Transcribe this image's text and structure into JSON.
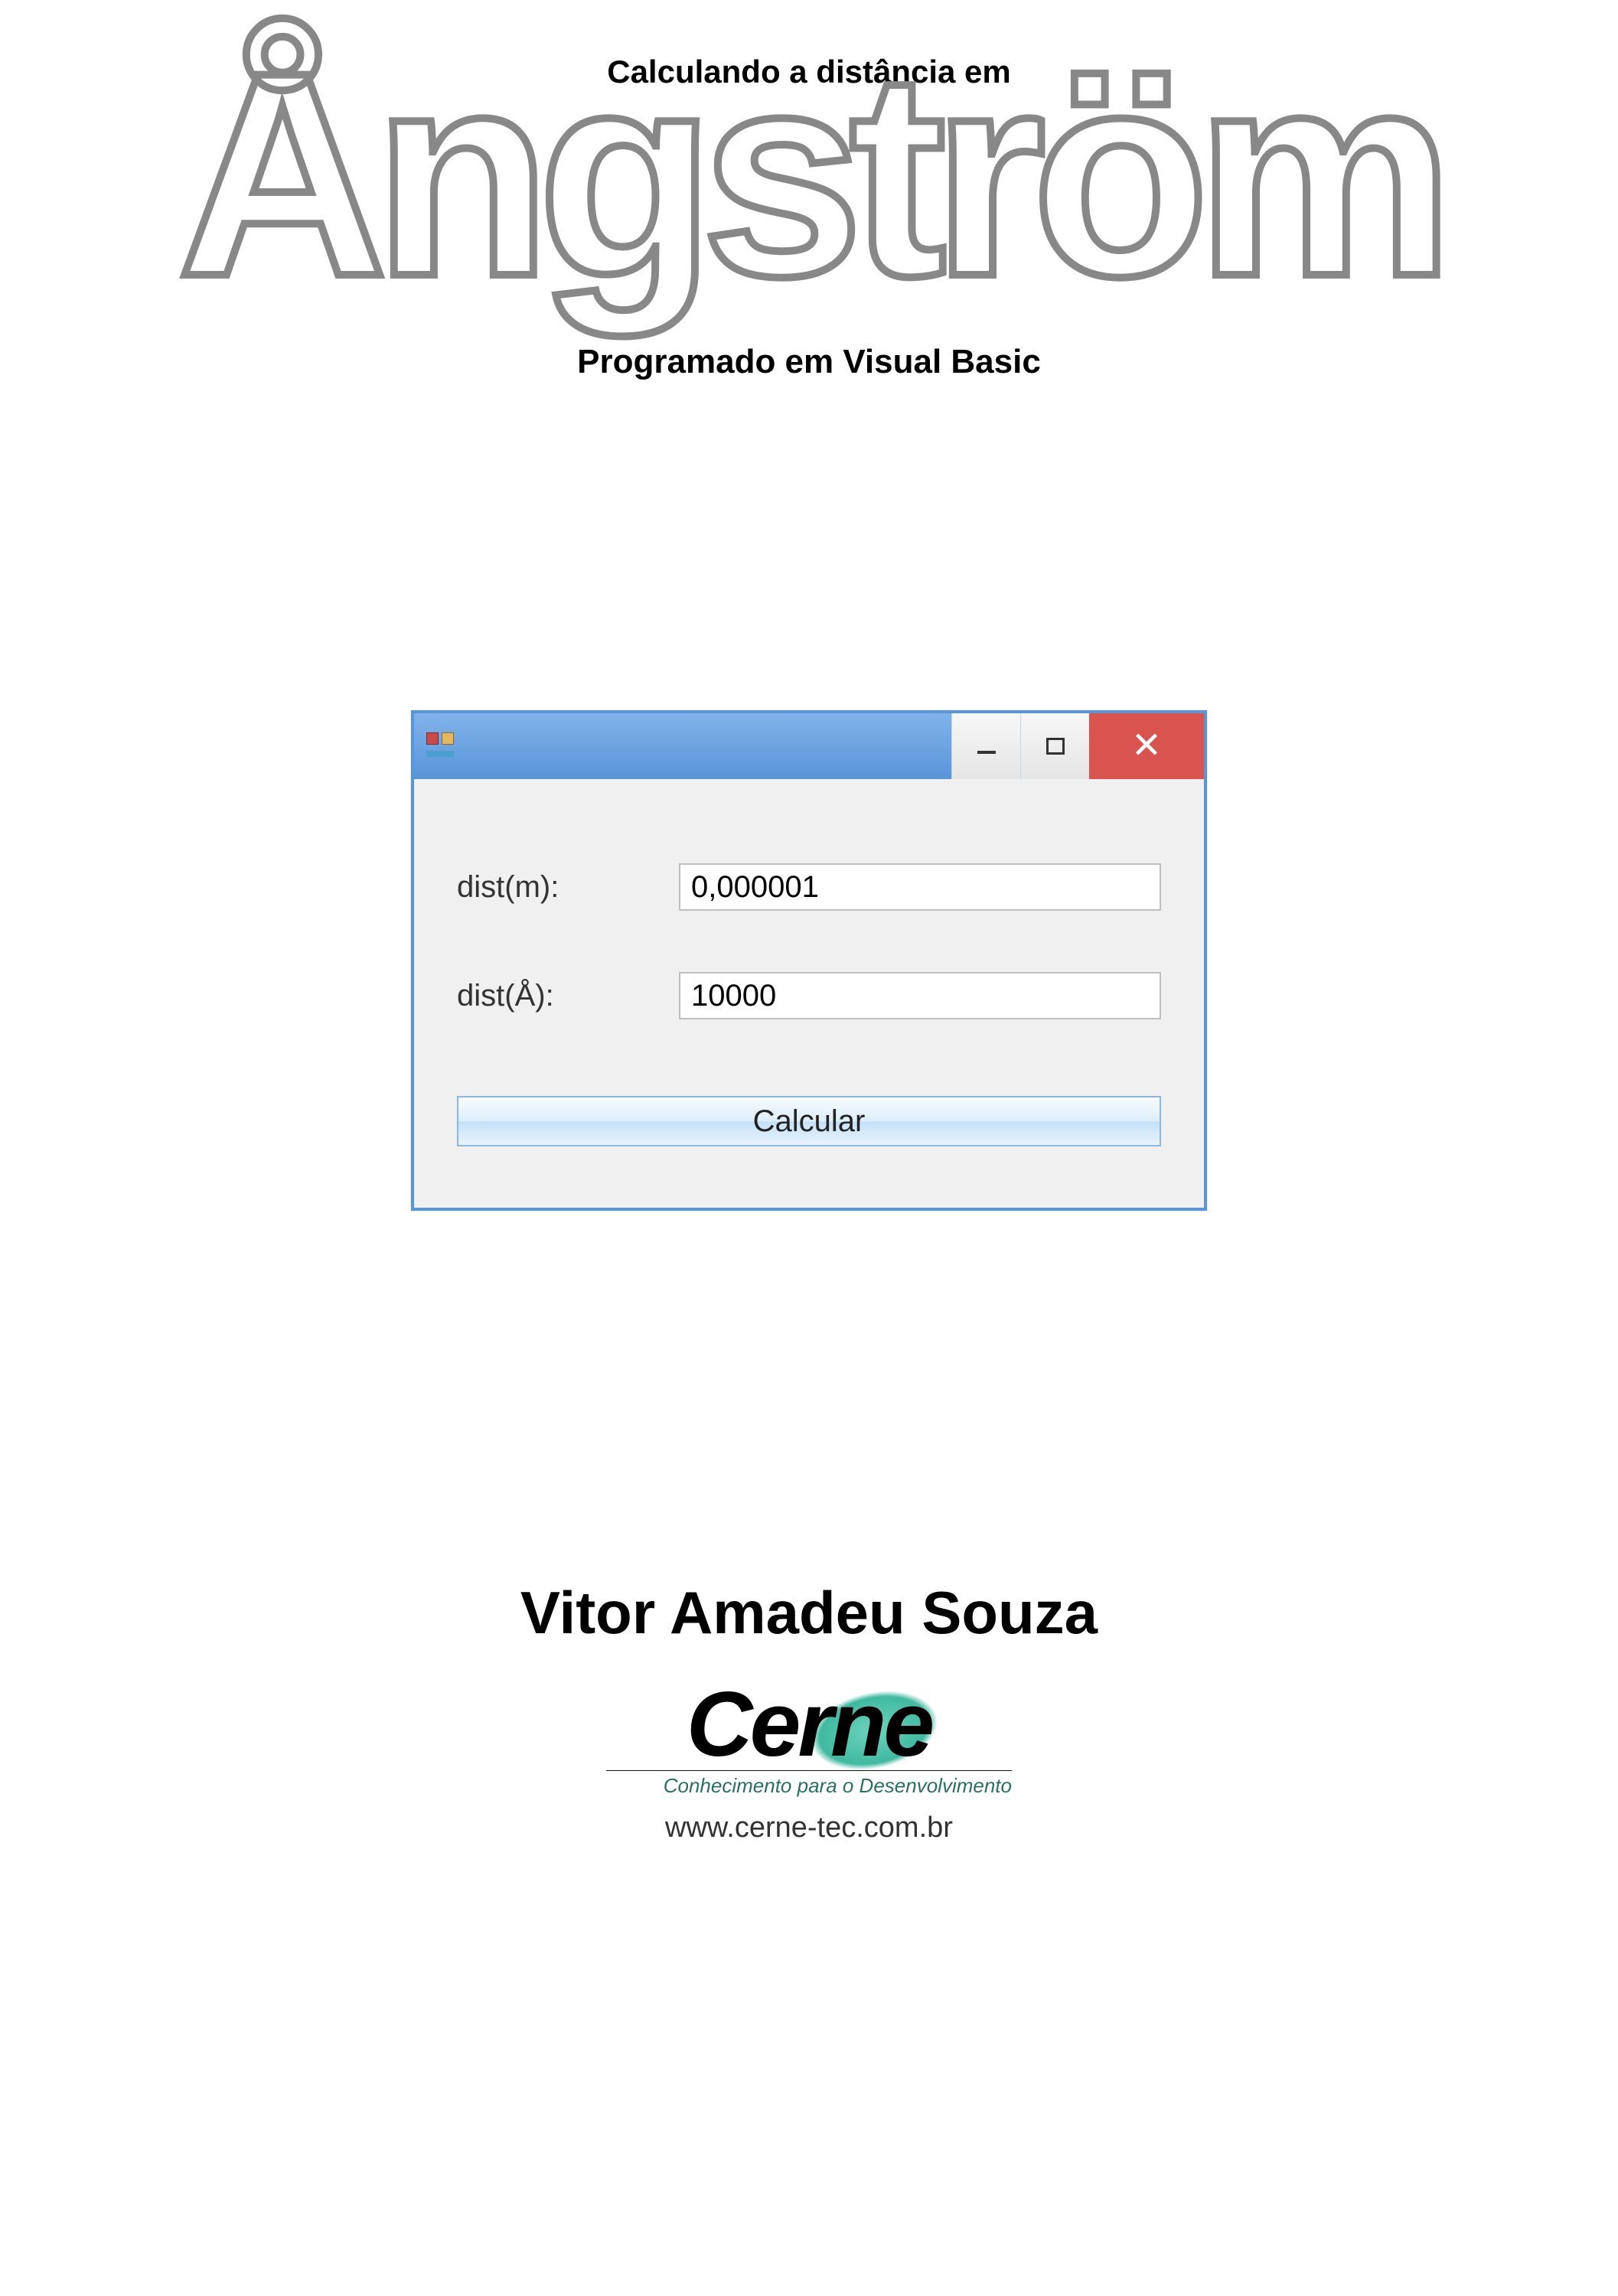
{
  "header": {
    "small_text": "Calculando a distância em",
    "big_title": "Ångström",
    "subtitle": "Programado em Visual Basic"
  },
  "window": {
    "title": "",
    "controls": {
      "minimize": "minimize",
      "maximize": "maximize",
      "close": "close"
    },
    "fields": {
      "dist_m": {
        "label": "dist(m):",
        "value": "0,000001"
      },
      "dist_a": {
        "label": "dist(Å):",
        "value": "10000"
      }
    },
    "button_label": "Calcular"
  },
  "footer": {
    "author": "Vitor Amadeu Souza",
    "logo_text": "Cerne",
    "logo_tagline": "Conhecimento para o Desenvolvimento",
    "url": "www.cerne-tec.com.br"
  }
}
